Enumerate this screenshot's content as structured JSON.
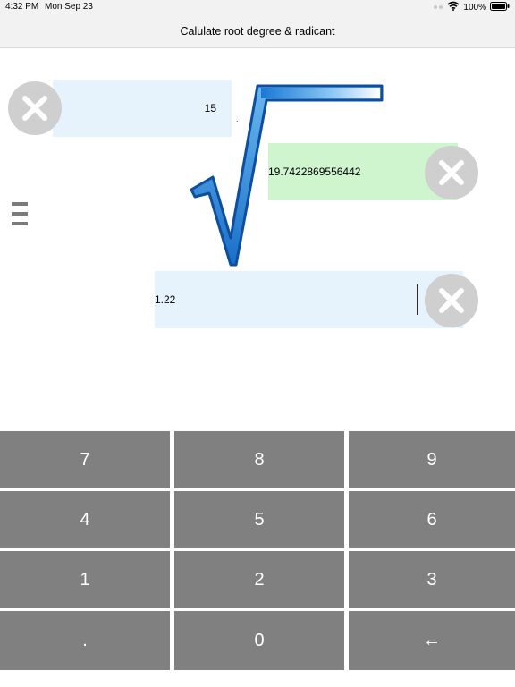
{
  "status_bar": {
    "time": "4:32 PM",
    "date": "Mon Sep 23",
    "battery_percent": "100%"
  },
  "nav": {
    "title": "Calulate root degree & radicant"
  },
  "fields": {
    "degree": "15",
    "result": "19.7422869556442",
    "radicand": "1.22"
  },
  "keypad": {
    "rows": [
      [
        "7",
        "8",
        "9"
      ],
      [
        "4",
        "5",
        "6"
      ],
      [
        "1",
        "2",
        "3"
      ],
      [
        ".",
        "0",
        "←"
      ]
    ]
  },
  "icons": {
    "clear": "close-icon",
    "menu": "hamburger-menu-icon",
    "radical": "square-root-icon",
    "wifi": "wifi-icon",
    "battery": "battery-icon"
  },
  "colors": {
    "input_bg": "#e6f3fc",
    "result_bg": "#cff5cf",
    "key_bg": "#808080",
    "radical_blue": "#3a9ee8"
  }
}
